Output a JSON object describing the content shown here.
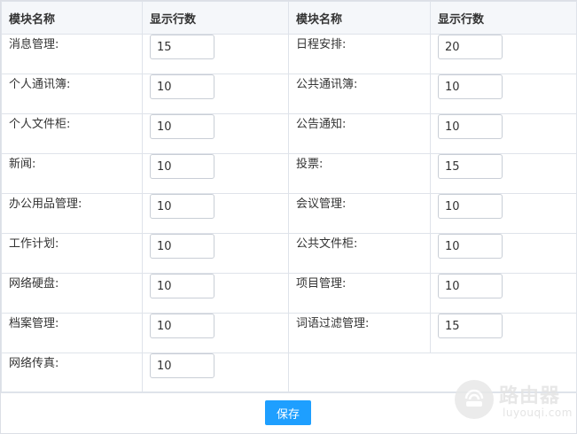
{
  "header": {
    "col1": "模块名称",
    "col2": "显示行数",
    "col3": "模块名称",
    "col4": "显示行数"
  },
  "rows": [
    {
      "left": {
        "label": "消息管理:",
        "value": "15"
      },
      "right": {
        "label": "日程安排:",
        "value": "20"
      }
    },
    {
      "left": {
        "label": "个人通讯簿:",
        "value": "10"
      },
      "right": {
        "label": "公共通讯簿:",
        "value": "10"
      }
    },
    {
      "left": {
        "label": "个人文件柜:",
        "value": "10"
      },
      "right": {
        "label": "公告通知:",
        "value": "10"
      }
    },
    {
      "left": {
        "label": "新闻:",
        "value": "10"
      },
      "right": {
        "label": "投票:",
        "value": "15"
      }
    },
    {
      "left": {
        "label": "办公用品管理:",
        "value": "10"
      },
      "right": {
        "label": "会议管理:",
        "value": "10"
      }
    },
    {
      "left": {
        "label": "工作计划:",
        "value": "10"
      },
      "right": {
        "label": "公共文件柜:",
        "value": "10"
      }
    },
    {
      "left": {
        "label": "网络硬盘:",
        "value": "10"
      },
      "right": {
        "label": "项目管理:",
        "value": "10"
      }
    },
    {
      "left": {
        "label": "档案管理:",
        "value": "10"
      },
      "right": {
        "label": "词语过滤管理:",
        "value": "15"
      }
    },
    {
      "left": {
        "label": "网络传真:",
        "value": "10"
      }
    }
  ],
  "footer": {
    "save_label": "保存"
  },
  "watermark": {
    "title": "路由器",
    "url": "luyouqi.com"
  },
  "colors": {
    "accent": "#1e9fff",
    "header_bg": "#f5f7fa",
    "border": "#dfe3ea"
  }
}
